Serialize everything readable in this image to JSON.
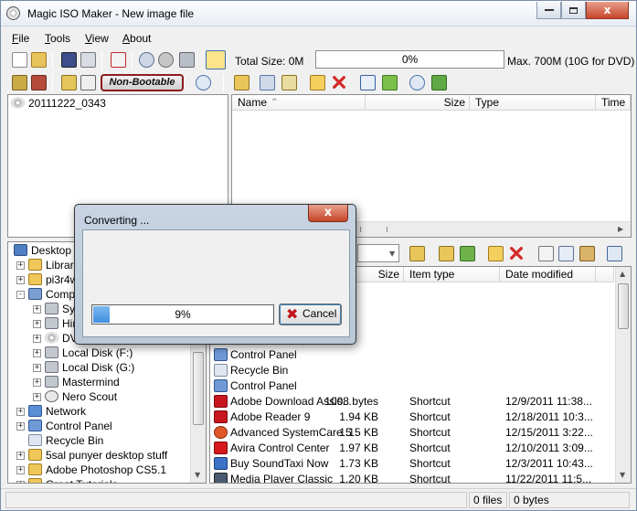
{
  "window": {
    "title": "Magic ISO Maker - New image file",
    "minimize_glyph": "",
    "close_glyph": "x"
  },
  "menu": [
    {
      "label": "File",
      "accel": "F",
      "rest": "ile"
    },
    {
      "label": "Tools",
      "accel": "T",
      "rest": "ools"
    },
    {
      "label": "View",
      "accel": "V",
      "rest": "iew"
    },
    {
      "label": "About",
      "accel": "A",
      "rest": "bout"
    }
  ],
  "toolbar": {
    "total_size": "Total Size: 0M",
    "progress_text": "0%",
    "max_label": "Max. 700M (10G for DVD)",
    "boot_label": "Non-Bootable"
  },
  "iso_tree": {
    "root": "20111222_0343"
  },
  "iso_list": {
    "columns": [
      "Name",
      "Size",
      "Type",
      "Time"
    ]
  },
  "local_tree": {
    "items": [
      {
        "label": "Desktop",
        "icon": "desktop-icon"
      },
      {
        "label": "Librarie",
        "icon": "folder-icon"
      },
      {
        "label": "pi3r4w",
        "icon": "user-folder-icon"
      },
      {
        "label": "Compu",
        "icon": "computer-icon"
      },
      {
        "label": "Sys",
        "icon": "drive-icon"
      },
      {
        "label": "Hir",
        "icon": "drive-icon"
      },
      {
        "label": "DV",
        "icon": "dvd-icon"
      },
      {
        "label": "Local Disk (F:)",
        "icon": "drive-icon"
      },
      {
        "label": "Local Disk (G:)",
        "icon": "drive-icon"
      },
      {
        "label": "Mastermind",
        "icon": "drive-icon"
      },
      {
        "label": "Nero Scout",
        "icon": "nero-scout-icon"
      },
      {
        "label": "Network",
        "icon": "network-icon"
      },
      {
        "label": "Control Panel",
        "icon": "control-panel-icon"
      },
      {
        "label": "Recycle Bin",
        "icon": "recycle-bin-icon"
      },
      {
        "label": "5sal punyer desktop stuff",
        "icon": "folder-icon"
      },
      {
        "label": "Adobe Photoshop CS5.1",
        "icon": "folder-icon"
      },
      {
        "label": "Great Tutorials",
        "icon": "folder-icon"
      }
    ]
  },
  "local_list": {
    "columns": [
      "Size",
      "Item type",
      "Date modified"
    ],
    "rows": [
      {
        "name": "Control Panel",
        "size": "",
        "type": "",
        "date": "",
        "icon": "control-panel-icon"
      },
      {
        "name": "Recycle Bin",
        "size": "",
        "type": "",
        "date": "",
        "icon": "recycle-bin-icon"
      },
      {
        "name": "Control Panel",
        "size": "",
        "type": "",
        "date": "",
        "icon": "control-panel-icon"
      },
      {
        "name": "Adobe Download Assis...",
        "size": "1008 bytes",
        "type": "Shortcut",
        "date": "12/9/2011 11:38...",
        "icon": "adobe-icon"
      },
      {
        "name": "Adobe Reader 9",
        "size": "1.94 KB",
        "type": "Shortcut",
        "date": "12/18/2011 10:3...",
        "icon": "adobe-reader-icon"
      },
      {
        "name": "Advanced SystemCare 5",
        "size": "1.15 KB",
        "type": "Shortcut",
        "date": "12/15/2011 3:22...",
        "icon": "systemcare-icon"
      },
      {
        "name": "Avira Control Center",
        "size": "1.97 KB",
        "type": "Shortcut",
        "date": "12/10/2011 3:09...",
        "icon": "avira-icon"
      },
      {
        "name": "Buy SoundTaxi Now",
        "size": "1.73 KB",
        "type": "Shortcut",
        "date": "12/3/2011 10:43...",
        "icon": "soundtaxi-icon"
      },
      {
        "name": "Media Player Classic",
        "size": "1.20 KB",
        "type": "Shortcut",
        "date": "11/22/2011 11:5...",
        "icon": "media-player-icon"
      }
    ]
  },
  "status": {
    "files": "0 files",
    "bytes": "0 bytes"
  },
  "dialog": {
    "title": "Converting ...",
    "progress": 0.09,
    "progress_text": "9%",
    "cancel_label": "Cancel"
  },
  "colors": {
    "accent": "#3e8ee0",
    "close_red": "#c7462a",
    "boot_border": "#8b1d1d"
  }
}
